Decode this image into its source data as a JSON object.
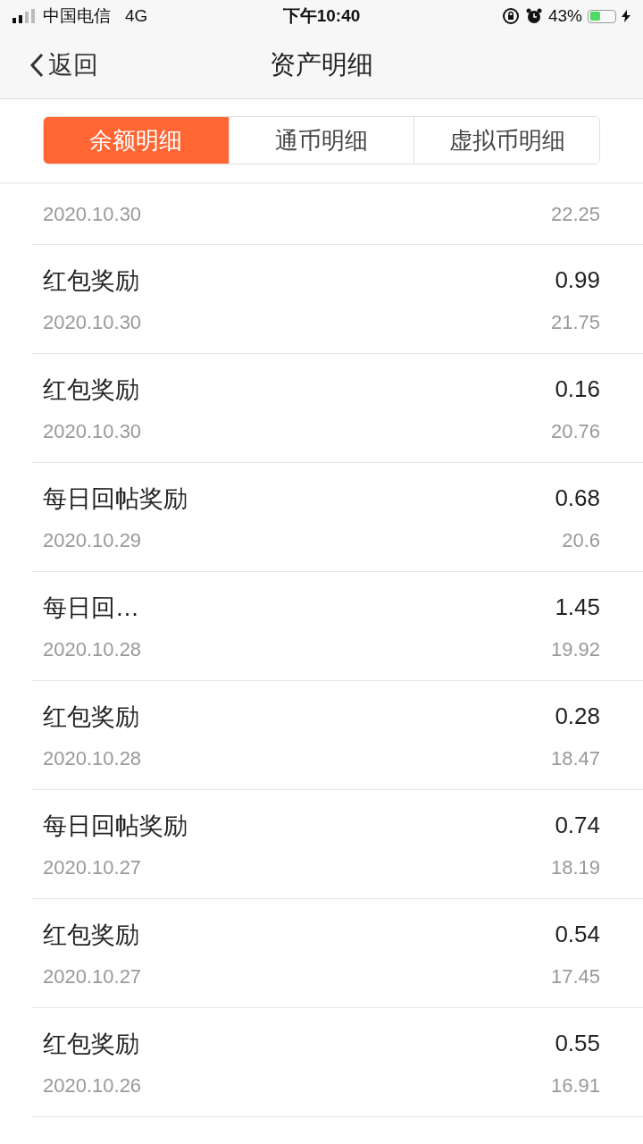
{
  "status_bar": {
    "carrier": "中国电信",
    "network": "4G",
    "time": "下午10:40",
    "battery_percent": "43%",
    "charging": true
  },
  "nav": {
    "back": "返回",
    "title": "资产明细"
  },
  "tabs": [
    {
      "label": "余额明细",
      "selected": true
    },
    {
      "label": "通币明细",
      "selected": false
    },
    {
      "label": "虚拟币明细",
      "selected": false
    }
  ],
  "records": [
    {
      "date": "2020.10.30",
      "balance": "22.25"
    },
    {
      "title": "红包奖励",
      "amount": "0.99",
      "date": "2020.10.30",
      "balance": "21.75"
    },
    {
      "title": "红包奖励",
      "amount": "0.16",
      "date": "2020.10.30",
      "balance": "20.76"
    },
    {
      "title": "每日回帖奖励",
      "amount": "0.68",
      "date": "2020.10.29",
      "balance": "20.6"
    },
    {
      "title": "每日回…",
      "amount": "1.45",
      "date": "2020.10.28",
      "balance": "19.92"
    },
    {
      "title": "红包奖励",
      "amount": "0.28",
      "date": "2020.10.28",
      "balance": "18.47"
    },
    {
      "title": "每日回帖奖励",
      "amount": "0.74",
      "date": "2020.10.27",
      "balance": "18.19"
    },
    {
      "title": "红包奖励",
      "amount": "0.54",
      "date": "2020.10.27",
      "balance": "17.45"
    },
    {
      "title": "红包奖励",
      "amount": "0.55",
      "date": "2020.10.26",
      "balance": "16.91"
    }
  ]
}
